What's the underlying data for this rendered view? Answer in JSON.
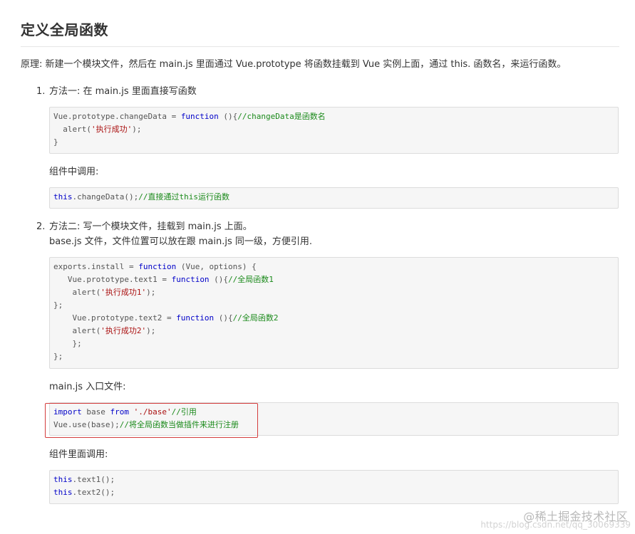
{
  "title": "定义全局函数",
  "principle": "原理: 新建一个模块文件，然后在 main.js 里面通过 Vue.prototype 将函数挂载到 Vue 实例上面，通过 this. 函数名，来运行函数。",
  "method1": {
    "number": "1.",
    "heading": "方法一: 在 main.js 里面直接写函数",
    "code": [
      [
        [
          "Vue.prototype.changeData = ",
          ""
        ],
        [
          "function",
          "kw"
        ],
        [
          " (){",
          ""
        ],
        [
          "//changeData是函数名",
          "cmt"
        ]
      ],
      [
        [
          "  alert(",
          ""
        ],
        [
          "'执行成功'",
          "str"
        ],
        [
          ");",
          ""
        ]
      ],
      [
        [
          "}",
          ""
        ]
      ]
    ],
    "call_label": "组件中调用:",
    "call_code": [
      [
        [
          "this",
          "kw"
        ],
        [
          ".changeData();",
          ""
        ],
        [
          "//直接通过this运行函数",
          "cmt"
        ]
      ]
    ]
  },
  "method2": {
    "number": "2.",
    "heading": "方法二: 写一个模块文件，挂载到 main.js 上面。",
    "subheading": "base.js 文件，文件位置可以放在跟 main.js 同一级，方便引用.",
    "code": [
      [
        [
          "exports.install = ",
          ""
        ],
        [
          "function",
          "kw"
        ],
        [
          " (Vue, options) {",
          ""
        ]
      ],
      [
        [
          "   Vue.prototype.text1 = ",
          ""
        ],
        [
          "function",
          "kw"
        ],
        [
          " (){",
          ""
        ],
        [
          "//全局函数1",
          "cmt"
        ]
      ],
      [
        [
          "    alert(",
          ""
        ],
        [
          "'执行成功1'",
          "str"
        ],
        [
          ");",
          ""
        ]
      ],
      [
        [
          "};",
          ""
        ]
      ],
      [
        [
          "    Vue.prototype.text2 = ",
          ""
        ],
        [
          "function",
          "kw"
        ],
        [
          " (){",
          ""
        ],
        [
          "//全局函数2",
          "cmt"
        ]
      ],
      [
        [
          "    alert(",
          ""
        ],
        [
          "'执行成功2'",
          "str"
        ],
        [
          ");",
          ""
        ]
      ],
      [
        [
          "    };",
          ""
        ]
      ],
      [
        [
          "};",
          ""
        ]
      ]
    ],
    "main_label": "main.js 入口文件:",
    "main_code": [
      [
        [
          "import",
          "kw"
        ],
        [
          " base ",
          ""
        ],
        [
          "from",
          "kw"
        ],
        [
          " ",
          ""
        ],
        [
          "'./base'",
          "str"
        ],
        [
          "//引用",
          "cmt"
        ]
      ],
      [
        [
          "Vue.use(base);",
          ""
        ],
        [
          "//将全局函数当做插件来进行注册",
          "cmt"
        ]
      ]
    ],
    "call_label": "组件里面调用:",
    "call_code": [
      [
        [
          "this",
          "kw"
        ],
        [
          ".text1();",
          ""
        ]
      ],
      [
        [
          "this",
          "kw"
        ],
        [
          ".text2();",
          ""
        ]
      ]
    ]
  },
  "watermark": {
    "main": "@稀土掘金技术社区",
    "url": "https://blog.csdn.net/qq_30069339"
  }
}
